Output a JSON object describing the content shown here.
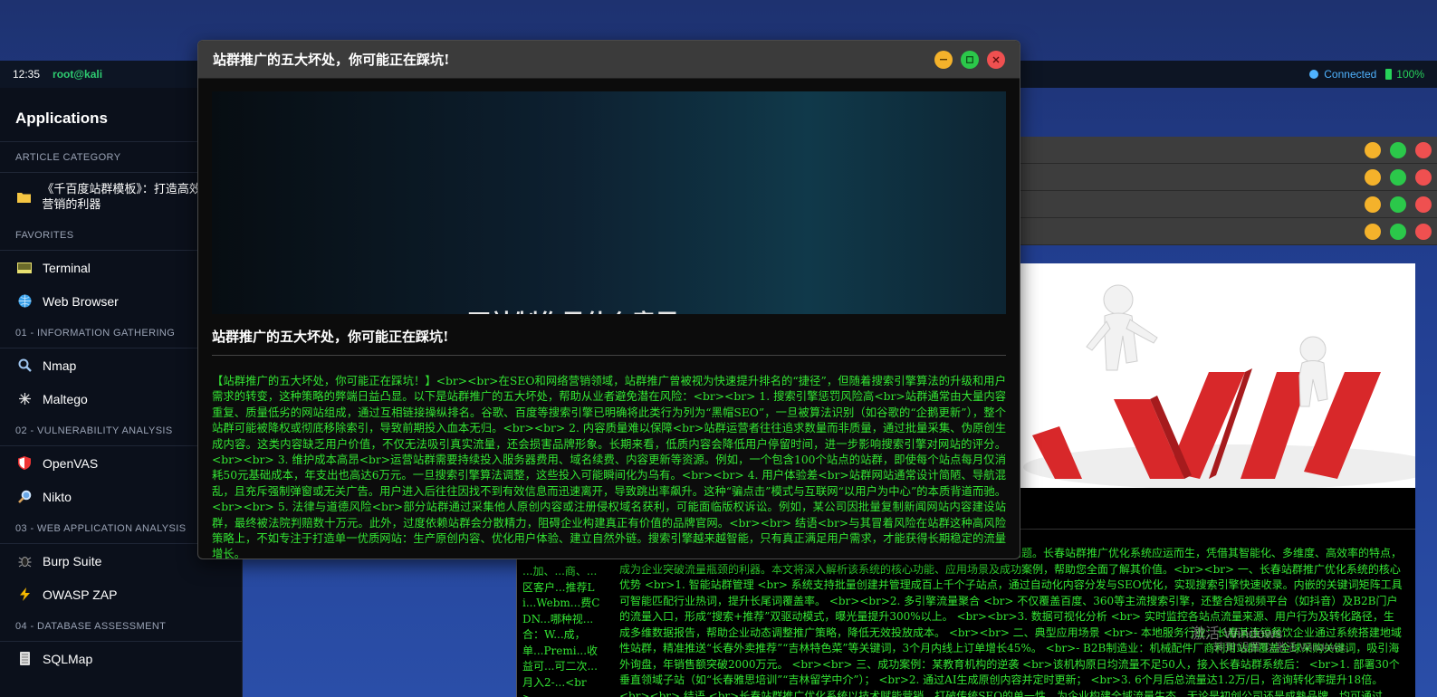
{
  "topbar": {
    "time": "12:35",
    "user": "root@kali",
    "connection": "Connected",
    "battery": "100%"
  },
  "sidebar": {
    "title": "Applications",
    "sections": [
      {
        "title": "ARTICLE CATEGORY",
        "items": [
          {
            "label": "《千百度站群模板》：打造高效网络营销的利器",
            "icon": "folder-icon"
          }
        ]
      },
      {
        "title": "FAVORITES",
        "items": [
          {
            "label": "Terminal",
            "icon": "terminal-icon"
          },
          {
            "label": "Web Browser",
            "icon": "globe-icon"
          }
        ]
      },
      {
        "title": "01 - INFORMATION GATHERING",
        "items": [
          {
            "label": "Nmap",
            "icon": "magnifier-icon"
          },
          {
            "label": "Maltego",
            "icon": "network-icon"
          }
        ]
      },
      {
        "title": "02 - VULNERABILITY ANALYSIS",
        "items": [
          {
            "label": "OpenVAS",
            "icon": "shield-icon"
          },
          {
            "label": "Nikto",
            "icon": "search-icon"
          }
        ]
      },
      {
        "title": "03 - WEB APPLICATION ANALYSIS",
        "items": [
          {
            "label": "Burp Suite",
            "icon": "bug-icon"
          },
          {
            "label": "OWASP ZAP",
            "icon": "lightning-icon"
          }
        ]
      },
      {
        "title": "04 - DATABASE ASSESSMENT",
        "items": [
          {
            "label": "SQLMap",
            "icon": "database-icon"
          }
        ]
      }
    ]
  },
  "modal": {
    "title": "站群推广的五大坏处，你可能正在踩坑!",
    "hero_caption": "网站制作是什么意思",
    "heading": "站群推广的五大坏处，你可能正在踩坑!",
    "body": "【站群推广的五大坏处，你可能正在踩坑！】<br><br>在SEO和网络营销领域，站群推广曾被视为快速提升排名的“捷径”，但随着搜索引擎算法的升级和用户需求的转变，这种策略的弊端日益凸显。以下是站群推广的五大坏处，帮助从业者避免潜在风险：<br><br> 1. 搜索引擎惩罚风险高<br>站群通常由大量内容重复、质量低劣的网站组成，通过互相链接操纵排名。谷歌、百度等搜索引擎已明确将此类行为列为“黑帽SEO”，一旦被算法识别（如谷歌的“企鹅更新”），整个站群可能被降权或彻底移除索引，导致前期投入血本无归。<br><br> 2. 内容质量难以保障<br>站群运营者往往追求数量而非质量，通过批量采集、伪原创生成内容。这类内容缺乏用户价值，不仅无法吸引真实流量，还会损害品牌形象。长期来看，低质内容会降低用户停留时间，进一步影响搜索引擎对网站的评分。<br><br> 3. 维护成本高昂<br>运营站群需要持续投入服务器费用、域名续费、内容更新等资源。例如，一个包含100个站点的站群，即使每个站点每月仅消耗50元基础成本，年支出也高达6万元。一旦搜索引擎算法调整，这些投入可能瞬间化为乌有。<br><br> 4. 用户体验差<br>站群网站通常设计简陋、导航混乱，且充斥强制弹窗或无关广告。用户进入后往往因找不到有效信息而迅速离开，导致跳出率飙升。这种“骗点击”模式与互联网“以用户为中心”的本质背道而驰。<br><br> 5. 法律与道德风险<br>部分站群通过采集他人原创内容或注册侵权域名获利，可能面临版权诉讼。例如，某公司因批量复制新闻网站内容建设站群，最终被法院判赔数十万元。此外，过度依赖站群会分散精力，阻碍企业构建真正有价值的品牌官网。<br><br> 结语<br>与其冒着风险在站群这种高风险策略上，不如专注于打造单一优质网站：生产原创内容、优化用户体验、建立自然外链。搜索引擎越来越智能，只有真正满足用户需求，才能获得长期稳定的流量增长。"
  },
  "background": {
    "bottom_window_text": "业网络营销的竞争日益激烈，如何快速提升品牌曝光、精准触达目标用户成为关键问题。长春站群推广优化系统应运而生，凭借其智能化、多维度、高效率的特点，成为企业突破流量瓶颈的利器。本文将深入解析该系统的核心功能、应用场景及成功案例，帮助您全面了解其价值。<br><br> 一、长春站群推广优化系统的核心优势 <br>1. 智能站群管理 <br> 系统支持批量创建并管理成百上千个子站点，通过自动化内容分发与SEO优化，实现搜索引擎快速收录。内嵌的关键词矩阵工具可智能匹配行业热词，提升长尾词覆盖率。 <br><br>2. 多引擎流量聚合 <br> 不仅覆盖百度、360等主流搜索引擎，还整合短视频平台（如抖音）及B2B门户的流量入口，形成“搜索+推荐”双驱动模式，曝光量提升300%以上。 <br><br>3. 数据可视化分析 <br> 实时监控各站点流量来源、用户行为及转化路径，生成多维数据报告，帮助企业动态调整推广策略，降低无效投放成本。 <br><br> 二、典型应用场景 <br>- 本地服务行业：长春某连锁餐饮企业通过系统搭建地域性站群，精准推送“长春外卖推荐”“吉林特色菜”等关键词，3个月内线上订单增长45%。 <br>- B2B制造业：机械配件厂商利用站群覆盖全球采购关键词，吸引海外询盘，年销售额突破2000万元。 <br><br> 三、成功案例：某教育机构的逆袭 <br>该机构原日均流量不足50人，接入长春站群系统后： <br>1. 部署30个垂直领域子站（如“长春雅思培训”“吉林留学中介”）； <br>2. 通过AI生成原创内容并定时更新； <br>3. 6个月后总流量达1.2万/日，咨询转化率提升18倍。 <br><br> 结语 <br>长春站群推广优化系统以技术赋能营销，打破传统SEO的单一性，为企业构建全域流量生态。无论是初创公司还是成熟品牌，均可通过",
    "narrow_window_text": "...加、...商、...区客户...推荐Li...Webm...费CDN...哪种视...合：W...成，单...Premi...收益可...可二次...月入2-...<br>...",
    "watermark": "激活 Windows",
    "watermark_sub": "转到“设置”以激活 Windows。"
  },
  "colors": {
    "accent_green": "#33e533",
    "user_green": "#2ecc71",
    "connected_blue": "#4fb3ff",
    "btn_min": "#f4b22b",
    "btn_max": "#2bc84a",
    "btn_close": "#ef5050"
  }
}
